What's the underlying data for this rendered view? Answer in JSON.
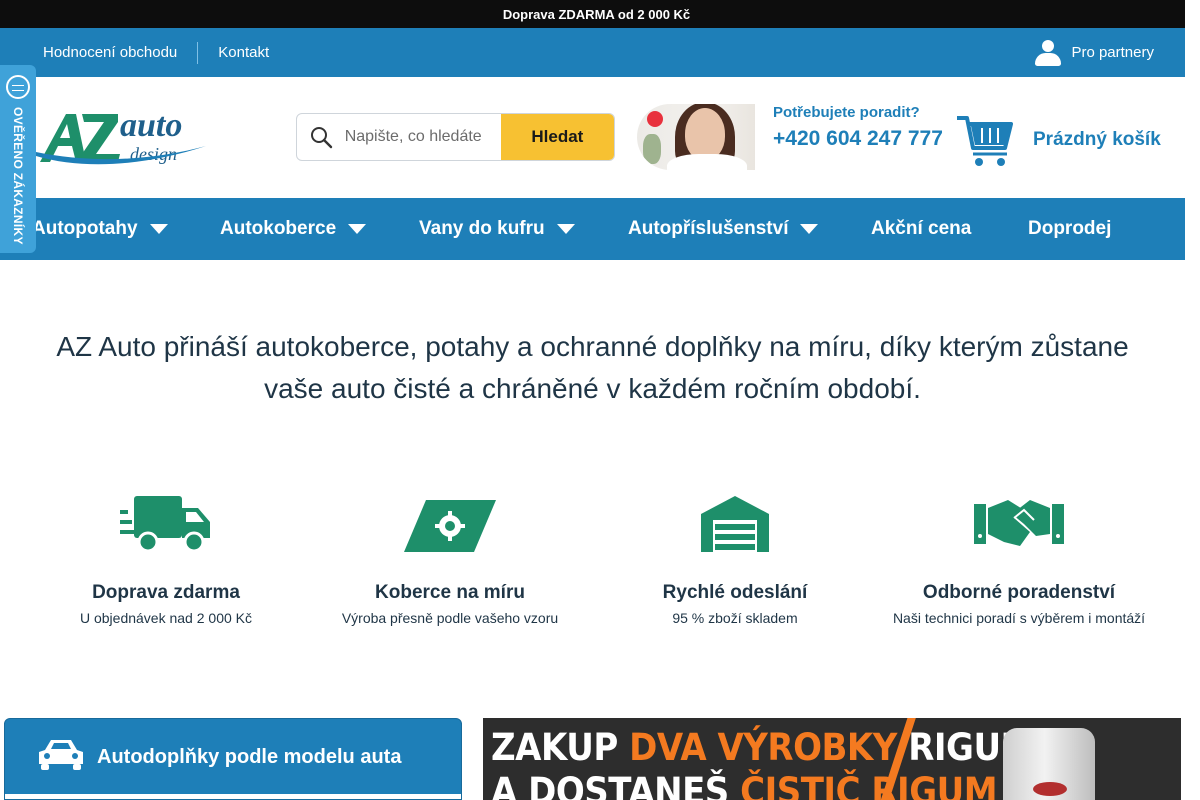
{
  "topbar": {
    "icon": "delivery-icon",
    "icon_glyph": "",
    "text": "Doprava ZDARMA od 2 000 Kč"
  },
  "secbar": {
    "links": [
      "Hodnocení obchodu",
      "Kontakt"
    ],
    "partners_label": "Pro partnery"
  },
  "side_badge": {
    "text": "OVĚŘENO ZÁKAZNÍKY"
  },
  "search": {
    "placeholder": "Napište, co hledáte",
    "button_label": "Hledat"
  },
  "contact": {
    "question": "Potřebujete poradit?",
    "phone": "+420 604 247 777"
  },
  "cart": {
    "label": "Prázdný košík"
  },
  "nav": {
    "items": [
      {
        "label": "Autopotahy",
        "dropdown": true
      },
      {
        "label": "Autokoberce",
        "dropdown": true
      },
      {
        "label": "Vany do kufru",
        "dropdown": true
      },
      {
        "label": "Autopříslušenství",
        "dropdown": true
      },
      {
        "label": "Akční cena",
        "dropdown": false
      },
      {
        "label": "Doprodej",
        "dropdown": false
      }
    ]
  },
  "hero": {
    "text": "AZ Auto přináší autokoberce, potahy a ochranné doplňky na míru, díky kterým zůstane vaše auto čisté a chráněné v každém ročním období."
  },
  "features": [
    {
      "icon": "truck-icon",
      "title": "Doprava zdarma",
      "desc": "U objednávek nad 2 000 Kč"
    },
    {
      "icon": "gear-ticket-icon",
      "title": "Koberce na míru",
      "desc": "Výroba přesně podle vašeho vzoru"
    },
    {
      "icon": "warehouse-icon",
      "title": "Rychlé odeslání",
      "desc": "95 % zboží skladem"
    },
    {
      "icon": "handshake-icon",
      "title": "Odborné poradenství",
      "desc": "Naši technici poradí s výběrem i montáží"
    }
  ],
  "model_box": {
    "label": "Autodoplňky podle modelu auta"
  },
  "banner": {
    "line1_a": "ZAKUP ",
    "line1_b": "DVA VÝROBKY",
    "line1_c": " RIGUM",
    "line2_a": "A DOSTANEŠ ",
    "line2_b": "ČISTIČ RIGUM"
  },
  "colors": {
    "brand_blue": "#1e7fb8",
    "accent_yellow": "#f7c132",
    "banner_orange": "#f47a20",
    "topbar_black": "#0d0d0d"
  }
}
